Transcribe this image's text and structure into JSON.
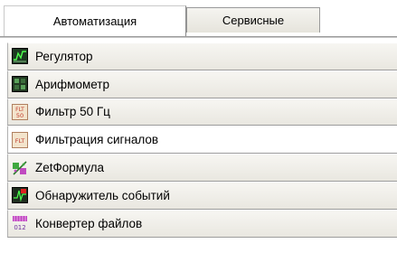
{
  "tabs": [
    {
      "label": "Автоматизация",
      "active": true
    },
    {
      "label": "Сервисные",
      "active": false
    }
  ],
  "items": [
    {
      "label": "Регулятор",
      "icon": "regulator-icon"
    },
    {
      "label": "Арифмометр",
      "icon": "arithmometer-icon"
    },
    {
      "label": "Фильтр 50 Гц",
      "icon": "filter-50hz-icon",
      "icon_text": "FLT 50"
    },
    {
      "label": "Фильтрация сигналов",
      "icon": "signal-filter-icon",
      "icon_text": "FLT",
      "selected": true
    },
    {
      "label": "ZetФормула",
      "icon": "formula-icon"
    },
    {
      "label": "Обнаружитель событий",
      "icon": "event-detector-icon"
    },
    {
      "label": "Конвертер файлов",
      "icon": "file-converter-icon",
      "icon_text": "012"
    }
  ]
}
